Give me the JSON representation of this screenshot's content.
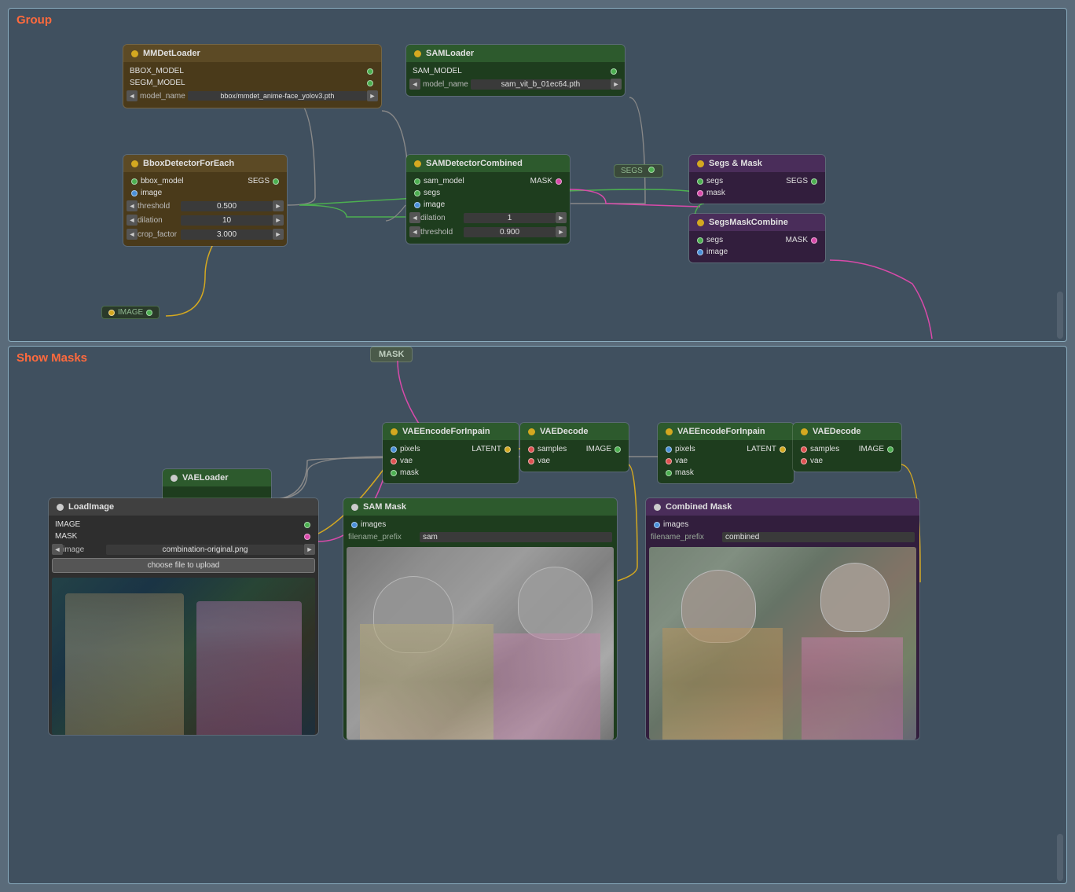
{
  "panels": {
    "group": {
      "title": "Group"
    },
    "showMasks": {
      "title": "Show Masks"
    }
  },
  "nodes": {
    "mmDetLoader": {
      "title": "MMDetLoader",
      "outputs": [
        "BBOX_MODEL",
        "SEGM_MODEL"
      ],
      "inputs": [
        {
          "label": "model_name",
          "value": "bbox/mmdet_anime-face_yolov3.pth"
        }
      ]
    },
    "samLoader": {
      "title": "SAMLoader",
      "outputs": [
        "SAM_MODEL"
      ],
      "inputs": [
        {
          "label": "model_name",
          "value": "sam_vit_b_01ec64.pth"
        }
      ]
    },
    "bboxDetector": {
      "title": "BboxDetectorForEach",
      "ports_in": [
        "bbox_model",
        "image"
      ],
      "ports_out": [
        "SEGS"
      ],
      "params": [
        {
          "label": "threshold",
          "value": "0.500"
        },
        {
          "label": "dilation",
          "value": "10"
        },
        {
          "label": "crop_factor",
          "value": "3.000"
        }
      ]
    },
    "samDetector": {
      "title": "SAMDetectorCombined",
      "ports_in": [
        "sam_model",
        "segs",
        "image"
      ],
      "ports_out": [
        "MASK"
      ],
      "params": [
        {
          "label": "dilation",
          "value": "1"
        },
        {
          "label": "threshold",
          "value": "0.900"
        }
      ]
    },
    "segsMask": {
      "title": "Segs & Mask",
      "ports_in": [
        "segs",
        "mask"
      ],
      "ports_out": [
        "SEGS"
      ]
    },
    "segsMaskCombine": {
      "title": "SegsMaskCombine",
      "ports_in": [
        "segs",
        "image"
      ],
      "ports_out": [
        "MASK"
      ]
    },
    "imageNode": {
      "label": "IMAGE"
    },
    "maskBadge": {
      "label": "MASK"
    },
    "vaeLoader": {
      "title": "VAELoader"
    },
    "vaeEncode1": {
      "title": "VAEEncodeForInpain",
      "ports_in": [
        "pixels",
        "vae",
        "mask"
      ],
      "ports_out": [
        "LATENT"
      ]
    },
    "vaeDecode1": {
      "title": "VAEDecode",
      "ports_in": [
        "samples",
        "vae"
      ],
      "ports_out": [
        "IMAGE"
      ]
    },
    "vaeEncode2": {
      "title": "VAEEncodeForInpain",
      "ports_in": [
        "pixels",
        "vae",
        "mask"
      ],
      "ports_out": [
        "LATENT"
      ]
    },
    "vaeDecode2": {
      "title": "VAEDecode",
      "ports_in": [
        "samples",
        "vae"
      ],
      "ports_out": [
        "IMAGE"
      ]
    },
    "loadImage": {
      "title": "LoadImage",
      "ports_out": [
        "IMAGE",
        "MASK"
      ],
      "params": [
        {
          "label": "image",
          "value": "combination-original.png"
        }
      ],
      "choose_file": "choose file to upload"
    },
    "samMask": {
      "title": "SAM Mask",
      "ports_in": [
        "images"
      ],
      "filename_prefix_label": "filename_prefix",
      "filename_prefix_value": "sam"
    },
    "combinedMask": {
      "title": "Combined Mask",
      "ports_in": [
        "images"
      ],
      "filename_prefix_label": "filename_prefix",
      "filename_prefix_value": "combined"
    }
  }
}
